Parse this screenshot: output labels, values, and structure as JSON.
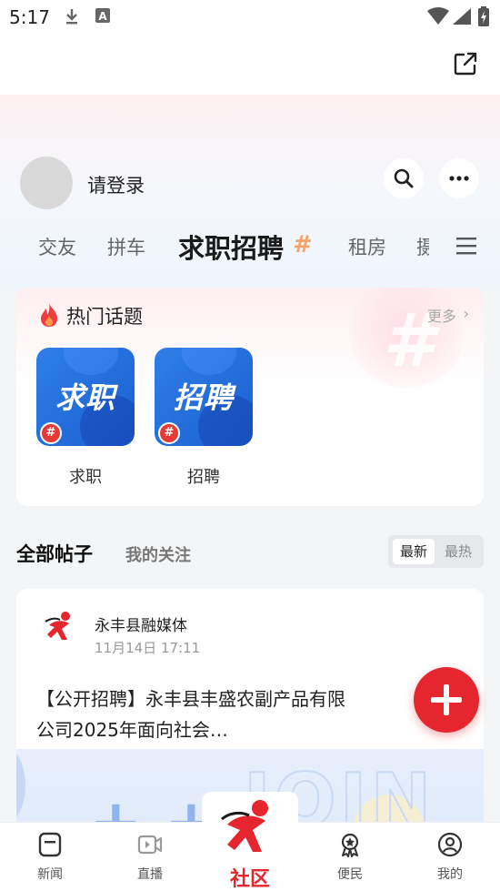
{
  "status_bar": {
    "time": "5:17",
    "icons": [
      "download-icon",
      "a-icon",
      "wifi-icon",
      "signal-icon",
      "battery-icon"
    ]
  },
  "header": {
    "login_text": "请登录",
    "buttons": [
      "search-icon",
      "more-icon",
      "share-icon"
    ]
  },
  "tabs": [
    {
      "label": "交友"
    },
    {
      "label": "拼车"
    },
    {
      "label": "求职招聘",
      "active": true
    },
    {
      "label": "租房"
    },
    {
      "label": "摄"
    }
  ],
  "hot_topics": {
    "title": "热门话题",
    "more": "更多",
    "items": [
      {
        "image_text": "求职",
        "label": "求职"
      },
      {
        "image_text": "招聘",
        "label": "招聘"
      }
    ]
  },
  "posts": {
    "tab_all": "全部帖子",
    "tab_follow": "我的关注",
    "sort_latest": "最新",
    "sort_hot": "最热",
    "items": [
      {
        "author": "永丰县融媒体",
        "time": "11月14日 17:11",
        "title": "【公开招聘】永丰县丰盛农副产品有限公司2025年面向社会…"
      }
    ]
  },
  "bottom_nav": [
    {
      "label": "新闻",
      "icon": "news-icon"
    },
    {
      "label": "直播",
      "icon": "live-icon"
    },
    {
      "label": "社区",
      "icon": "community-logo-icon",
      "active": true
    },
    {
      "label": "便民",
      "icon": "service-icon"
    },
    {
      "label": "我的",
      "icon": "profile-icon"
    }
  ],
  "colors": {
    "accent": "#e5262e",
    "topic_blue": "#1f6bd9",
    "tab_hash": "#f4a36a"
  }
}
